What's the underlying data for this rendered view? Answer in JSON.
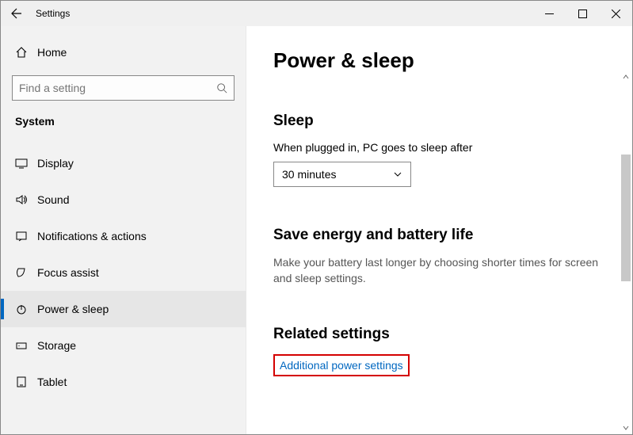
{
  "titlebar": {
    "title": "Settings"
  },
  "sidebar": {
    "home_label": "Home",
    "search_placeholder": "Find a setting",
    "category_label": "System",
    "items": [
      {
        "label": "Display"
      },
      {
        "label": "Sound"
      },
      {
        "label": "Notifications & actions"
      },
      {
        "label": "Focus assist"
      },
      {
        "label": "Power & sleep"
      },
      {
        "label": "Storage"
      },
      {
        "label": "Tablet"
      }
    ]
  },
  "main": {
    "page_title": "Power & sleep",
    "sleep": {
      "heading": "Sleep",
      "label": "When plugged in, PC goes to sleep after",
      "value": "30 minutes"
    },
    "energy": {
      "heading": "Save energy and battery life",
      "desc": "Make your battery last longer by choosing shorter times for screen and sleep settings."
    },
    "related": {
      "heading": "Related settings",
      "link": "Additional power settings"
    }
  }
}
